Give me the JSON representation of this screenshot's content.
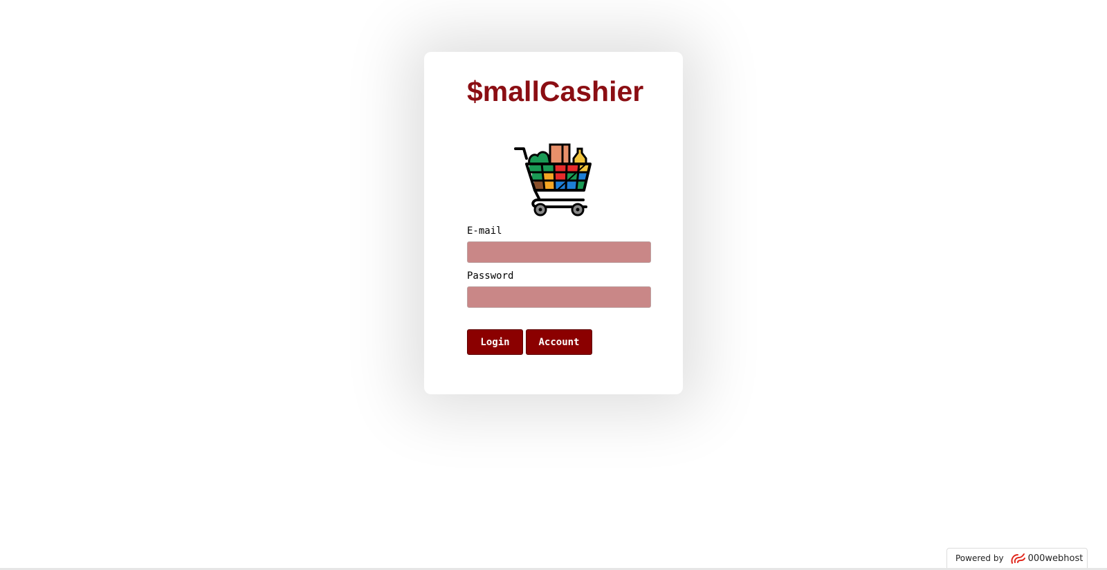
{
  "app": {
    "title": "$mallCashier"
  },
  "form": {
    "email_label": "E-mail",
    "email_value": "",
    "password_label": "Password",
    "password_value": "",
    "login_label": "Login",
    "account_label": "Account"
  },
  "footer": {
    "powered_by": "Powered by",
    "host_name": "000webhost"
  },
  "icons": {
    "logo": "shopping-cart-icon",
    "host_logo": "000webhost-logo-icon"
  },
  "colors": {
    "brand": "#8b0e13",
    "button_bg": "#8b0000",
    "input_bg": "#c98787"
  }
}
